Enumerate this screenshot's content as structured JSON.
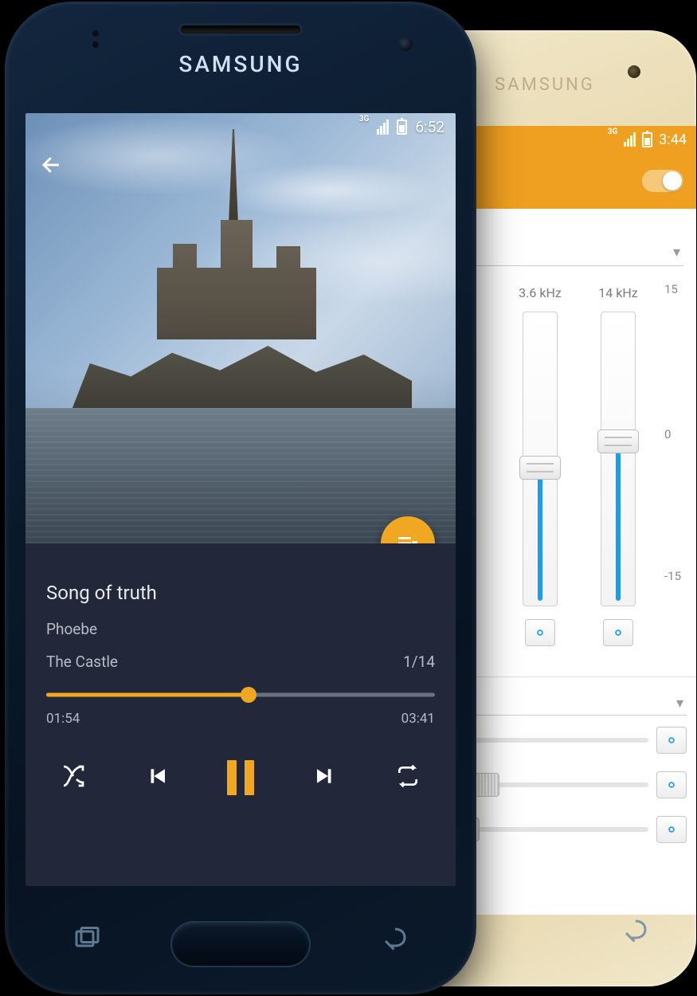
{
  "brand": "SAMSUNG",
  "front": {
    "status": {
      "network_label": "3G",
      "time": "6:52"
    },
    "player": {
      "song_title": "Song of truth",
      "artist": "Phoebe",
      "album": "The Castle",
      "track_index": "1/14",
      "elapsed": "01:54",
      "duration": "03:41",
      "progress_pct": 52
    }
  },
  "back": {
    "status": {
      "network_label": "3G",
      "time": "3:44"
    },
    "equalizer": {
      "enabled": true,
      "bands": [
        {
          "label": "3.6 kHz",
          "value_db": -1
        },
        {
          "label": "14 kHz",
          "value_db": 2
        }
      ],
      "scale": {
        "max_label": "15",
        "mid_label": "0",
        "min_label": "-15",
        "min": -15,
        "max": 15
      },
      "h_sliders": [
        {
          "value_pct": 18
        },
        {
          "value_pct": 32
        },
        {
          "value_pct": 24
        }
      ]
    }
  }
}
